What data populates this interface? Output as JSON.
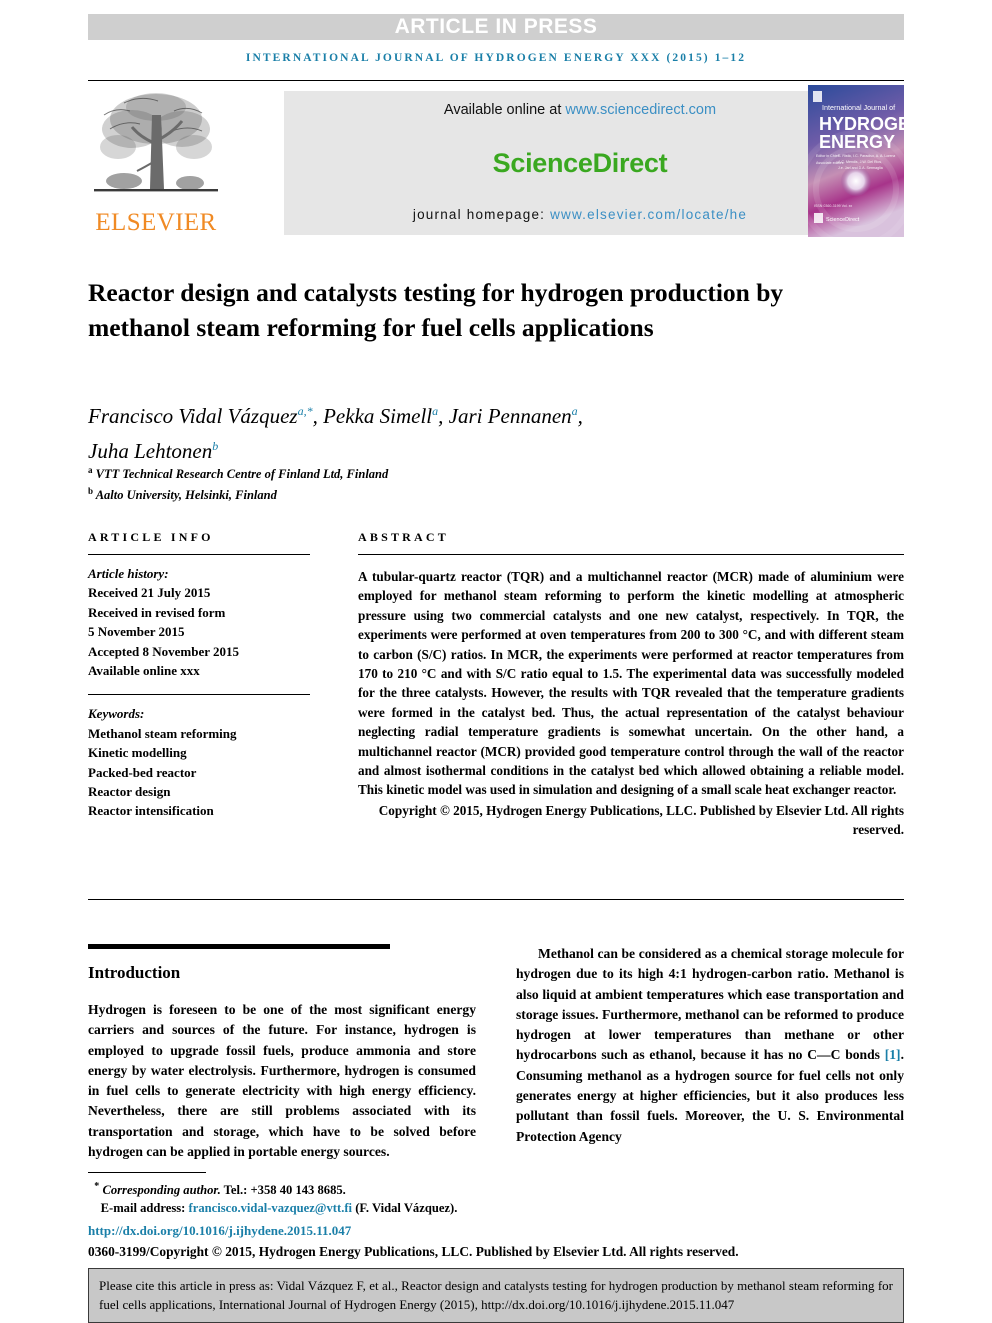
{
  "banner": {
    "article_in_press": "ARTICLE IN PRESS"
  },
  "running_head": "INTERNATIONAL JOURNAL OF HYDROGEN ENERGY XXX (2015) 1–12",
  "masthead": {
    "publisher_logo_text": "ELSEVIER",
    "available_online_prefix": "Available online at ",
    "sciencedirect_url": "www.sciencedirect.com",
    "sciencedirect_logo": "ScienceDirect",
    "homepage_prefix": "journal homepage: ",
    "homepage_url": "www.elsevier.com/locate/he",
    "cover": {
      "line1": "International Journal of",
      "line2": "HYDROGEN",
      "line3": "ENERGY",
      "editors_line1": "S. Ristic, I.C. Paradiso, A. A. Lorenz",
      "editors_line2": "A.C. Mendis, J.W. Del Rios,",
      "editors_line3": "J.e. Jarl and D.A. Sermaglia",
      "footer_brand": "ScienceDirect"
    }
  },
  "article": {
    "title": "Reactor design and catalysts testing for hydrogen production by methanol steam reforming for fuel cells applications",
    "authors": [
      {
        "name": "Francisco Vidal Vázquez",
        "marks": "a,*"
      },
      {
        "name": "Pekka Simell",
        "marks": "a"
      },
      {
        "name": "Jari Pennanen",
        "marks": "a"
      },
      {
        "name": "Juha Lehtonen",
        "marks": "b"
      }
    ],
    "affiliations": [
      {
        "mark": "a",
        "text": "VTT Technical Research Centre of Finland Ltd, Finland"
      },
      {
        "mark": "b",
        "text": "Aalto University, Helsinki, Finland"
      }
    ]
  },
  "article_info": {
    "heading": "ARTICLE INFO",
    "history_label": "Article history:",
    "history": [
      "Received 21 July 2015",
      "Received in revised form",
      "5 November 2015",
      "Accepted 8 November 2015",
      "Available online xxx"
    ],
    "keywords_label": "Keywords:",
    "keywords": [
      "Methanol steam reforming",
      "Kinetic modelling",
      "Packed-bed reactor",
      "Reactor design",
      "Reactor intensification"
    ]
  },
  "abstract": {
    "heading": "ABSTRACT",
    "text": "A tubular-quartz reactor (TQR) and a multichannel reactor (MCR) made of aluminium were employed for methanol steam reforming to perform the kinetic modelling at atmospheric pressure using two commercial catalysts and one new catalyst, respectively. In TQR, the experiments were performed at oven temperatures from 200 to 300 °C, and with different steam to carbon (S/C) ratios. In MCR, the experiments were performed at reactor temperatures from 170 to 210 °C and with S/C ratio equal to 1.5. The experimental data was successfully modeled for the three catalysts. However, the results with TQR revealed that the temperature gradients were formed in the catalyst bed. Thus, the actual representation of the catalyst behaviour neglecting radial temperature gradients is somewhat uncertain. On the other hand, a multichannel reactor (MCR) provided good temperature control through the wall of the reactor and almost isothermal conditions in the catalyst bed which allowed obtaining a reliable model. This kinetic model was used in simulation and designing of a small scale heat exchanger reactor.",
    "copyright": "Copyright © 2015, Hydrogen Energy Publications, LLC. Published by Elsevier Ltd. All rights reserved."
  },
  "body": {
    "section_heading": "Introduction",
    "left_paragraph": "Hydrogen is foreseen to be one of the most significant energy carriers and sources of the future. For instance, hydrogen is employed to upgrade fossil fuels, produce ammonia and store energy by water electrolysis. Furthermore, hydrogen is consumed in fuel cells to generate electricity with high energy efficiency. Nevertheless, there are still problems associated with its transportation and storage, which have to be solved before hydrogen can be applied in portable energy sources.",
    "right_paragraph_part1": "Methanol can be considered as a chemical storage molecule for hydrogen due to its high 4:1 hydrogen-carbon ratio. Methanol is also liquid at ambient temperatures which ease transportation and storage issues. Furthermore, methanol can be reformed to produce hydrogen at lower temperatures than methane or other hydrocarbons such as ethanol, because it has no C—C bonds ",
    "right_citation": "[1]",
    "right_paragraph_part2": ". Consuming methanol as a hydrogen source for fuel cells not only generates energy at higher efficiencies, but it also produces less pollutant than fossil fuels. Moreover, the U. S. Environmental Protection Agency"
  },
  "footnotes": {
    "corresponding_star": "*",
    "corresponding_label": "Corresponding author.",
    "tel": " Tel.: +358 40 143 8685.",
    "email_label": "E-mail address: ",
    "email": "francisco.vidal-vazquez@vtt.fi",
    "email_suffix": " (F. Vidal Vázquez).",
    "doi": "http://dx.doi.org/10.1016/j.ijhydene.2015.11.047",
    "issn_copyright": "0360-3199/Copyright © 2015, Hydrogen Energy Publications, LLC. Published by Elsevier Ltd. All rights reserved."
  },
  "cite_box": {
    "text": "Please cite this article in press as: Vidal Vázquez F, et al., Reactor design and catalysts testing for hydrogen production by methanol steam reforming for fuel cells applications, International Journal of Hydrogen Energy (2015), http://dx.doi.org/10.1016/j.ijhydene.2015.11.047"
  },
  "colors": {
    "banner_gray": "#cfcfcf",
    "link_blue": "#1a7fa8",
    "sciencedirect_green": "#3aa820",
    "elsevier_orange": "#f08a24",
    "panel_gray": "#e6e6e6",
    "cite_box_gray": "#c8c8c8"
  }
}
